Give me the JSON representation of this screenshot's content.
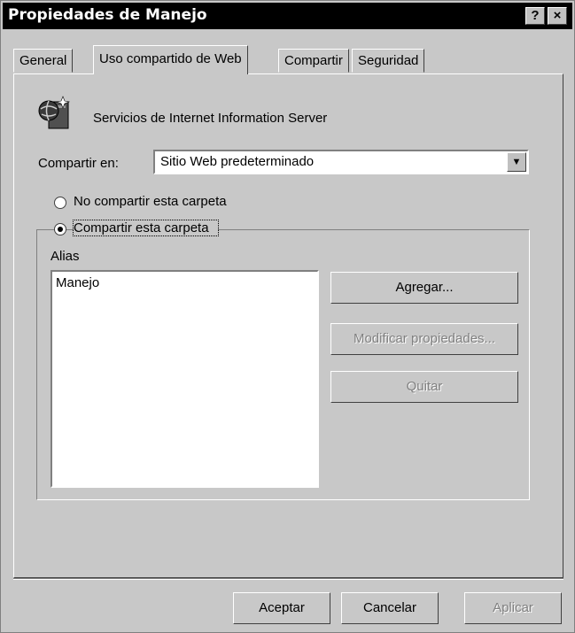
{
  "window": {
    "title": "Propiedades de Manejo",
    "help_button": "?",
    "close_button": "×"
  },
  "tabs": [
    {
      "label": "General",
      "active": false
    },
    {
      "label": "Uso compartido de Web",
      "active": true
    },
    {
      "label": "Compartir",
      "active": false
    },
    {
      "label": "Seguridad",
      "active": false
    }
  ],
  "panel": {
    "service_label": "Servicios de Internet Information Server",
    "service_icon": "iis-globe-icon",
    "share_on_label": "Compartir en:",
    "share_on_value": "Sitio Web predeterminado",
    "radio_no_share": "No compartir esta carpeta",
    "radio_share": "Compartir esta carpeta",
    "selected_option": "Compartir esta carpeta",
    "alias_label": "Alias",
    "aliases": [
      "Manejo"
    ],
    "add_button": "Agregar...",
    "modify_button": "Modificar propiedades...",
    "remove_button": "Quitar"
  },
  "footer": {
    "ok_button": "Aceptar",
    "cancel_button": "Cancelar",
    "apply_button": "Aplicar"
  }
}
